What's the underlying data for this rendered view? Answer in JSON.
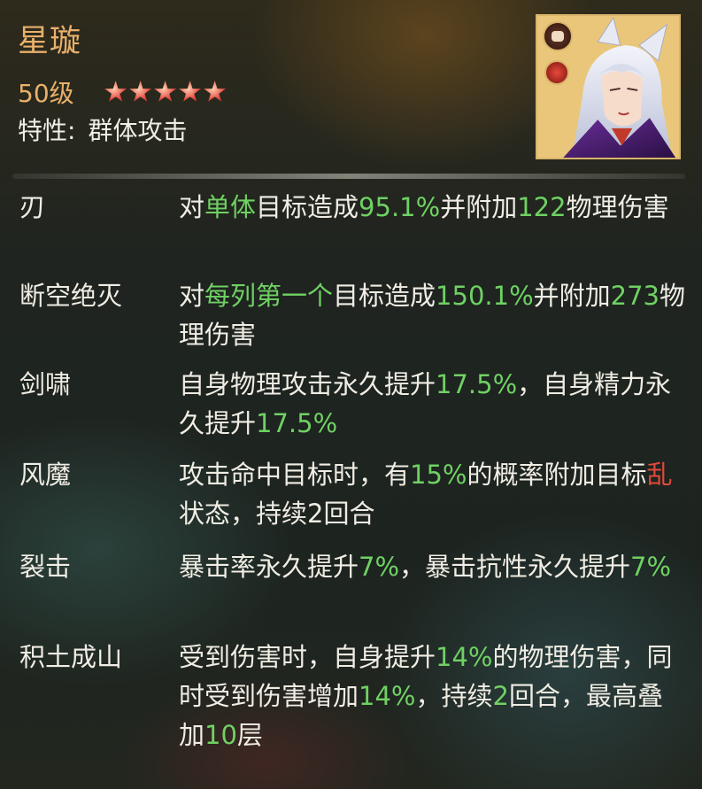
{
  "hero": {
    "name": "星璇",
    "level": "50级",
    "stars": 5,
    "trait_label": "特性:",
    "trait_value": "群体攻击"
  },
  "skills": [
    {
      "name": "刃",
      "desc": [
        {
          "t": "对",
          "c": "w"
        },
        {
          "t": "单体",
          "c": "g"
        },
        {
          "t": "目标造成",
          "c": "w"
        },
        {
          "t": "95.1%",
          "c": "g"
        },
        {
          "t": "并附加",
          "c": "w"
        },
        {
          "t": "122",
          "c": "g"
        },
        {
          "t": "物理伤害",
          "c": "w"
        }
      ]
    },
    {
      "name": "断空绝灭",
      "desc": [
        {
          "t": "对",
          "c": "w"
        },
        {
          "t": "每列第一个",
          "c": "g"
        },
        {
          "t": "目标造成",
          "c": "w"
        },
        {
          "t": "150.1%",
          "c": "g"
        },
        {
          "t": "并附加",
          "c": "w"
        },
        {
          "t": "273",
          "c": "g"
        },
        {
          "t": "物理伤害",
          "c": "w"
        }
      ]
    },
    {
      "name": "剑啸",
      "desc": [
        {
          "t": "自身物理攻击永久提升",
          "c": "w"
        },
        {
          "t": "17.5%",
          "c": "g"
        },
        {
          "t": "，自身精力永久提升",
          "c": "w"
        },
        {
          "t": "17.5%",
          "c": "g"
        }
      ]
    },
    {
      "name": "风魔",
      "desc": [
        {
          "t": "攻击命中目标时，有",
          "c": "w"
        },
        {
          "t": "15%",
          "c": "g"
        },
        {
          "t": "的概率附加目标",
          "c": "w"
        },
        {
          "t": "乱",
          "c": "r"
        },
        {
          "t": "状态，持续2回合",
          "c": "w"
        }
      ]
    },
    {
      "name": "裂击",
      "desc": [
        {
          "t": "暴击率永久提升",
          "c": "w"
        },
        {
          "t": "7%",
          "c": "g"
        },
        {
          "t": "，暴击抗性永久提升",
          "c": "w"
        },
        {
          "t": "7%",
          "c": "g"
        }
      ]
    },
    {
      "name": "积土成山",
      "desc": [
        {
          "t": "受到伤害时，自身提升",
          "c": "w"
        },
        {
          "t": "14%",
          "c": "g"
        },
        {
          "t": "的物理伤害，同时受到伤害增加",
          "c": "w"
        },
        {
          "t": "14%",
          "c": "g"
        },
        {
          "t": "，持续",
          "c": "w"
        },
        {
          "t": "2",
          "c": "g"
        },
        {
          "t": "回合，最高叠加",
          "c": "w"
        },
        {
          "t": "10",
          "c": "g"
        },
        {
          "t": "层",
          "c": "w"
        }
      ]
    }
  ],
  "colors": {
    "title": "#e8b06a",
    "text": "#f0ede4",
    "highlight_green": "#6fd163",
    "highlight_red": "#e14a3a",
    "star": "#e4473f"
  },
  "icons": {
    "portrait": "hero-portrait-fox-ears",
    "badge_top": "fist-badge-icon",
    "badge_bottom": "red-element-badge-icon"
  }
}
